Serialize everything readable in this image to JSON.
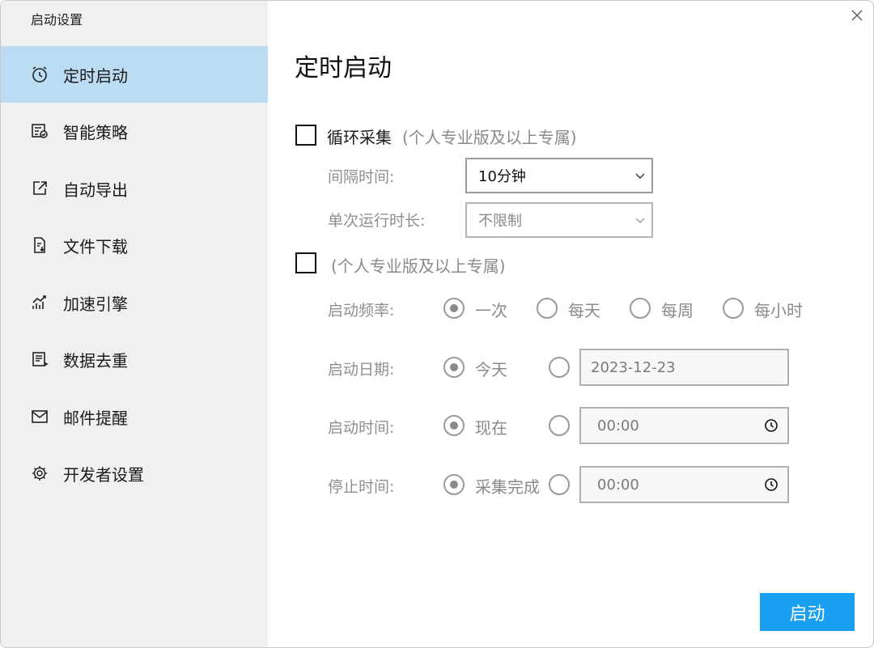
{
  "window": {
    "title": "启动设置"
  },
  "sidebar": {
    "items": [
      {
        "label": "定时启动",
        "icon": "alarm-clock-icon"
      },
      {
        "label": "智能策略",
        "icon": "strategy-icon"
      },
      {
        "label": "自动导出",
        "icon": "export-icon"
      },
      {
        "label": "文件下载",
        "icon": "file-download-icon"
      },
      {
        "label": "加速引擎",
        "icon": "chart-accelerate-icon"
      },
      {
        "label": "数据去重",
        "icon": "dedupe-icon"
      },
      {
        "label": "邮件提醒",
        "icon": "mail-icon"
      },
      {
        "label": "开发者设置",
        "icon": "gear-icon"
      }
    ]
  },
  "main": {
    "title": "定时启动",
    "loop": {
      "label": "循环采集",
      "note": "(个人专业版及以上专属)",
      "interval_label": "间隔时间:",
      "interval_value": "10分钟",
      "duration_label": "单次运行时长:",
      "duration_value": "不限制"
    },
    "schedule": {
      "note": "(个人专业版及以上专属)",
      "frequency_label": "启动频率:",
      "frequency_options": [
        "一次",
        "每天",
        "每周",
        "每小时"
      ],
      "date_label": "启动日期:",
      "date_option": "今天",
      "date_value": "2023-12-23",
      "time_label": "启动时间:",
      "time_option": "现在",
      "time_value": "00:00",
      "stop_label": "停止时间:",
      "stop_option": "采集完成",
      "stop_value": "00:00"
    },
    "start_button": "启动"
  },
  "colors": {
    "sidebar_bg": "#f0f0f0",
    "active_item_bg": "#bcdcf4",
    "accent": "#1a9ff0",
    "muted_text": "#8a8a8a"
  }
}
